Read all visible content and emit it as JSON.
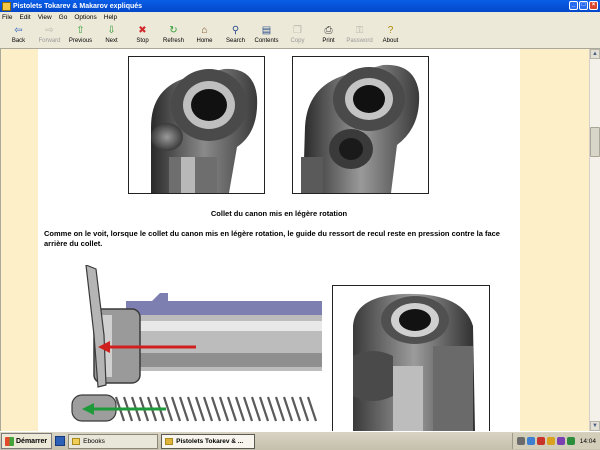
{
  "window": {
    "title": "Pistolets Tokarev & Makarov expliqués"
  },
  "menu": [
    "File",
    "Edit",
    "View",
    "Go",
    "Options",
    "Help"
  ],
  "toolbar": [
    {
      "label": "Back",
      "icon": "back-arrow-icon",
      "glyph": "⇦",
      "color": "#2f67c6",
      "enabled": true
    },
    {
      "label": "Forward",
      "icon": "forward-arrow-icon",
      "glyph": "⇨",
      "color": "#7b7b7b",
      "enabled": false
    },
    {
      "label": "Previous",
      "icon": "up-arrow-icon",
      "glyph": "⇧",
      "color": "#2f9c32",
      "enabled": true
    },
    {
      "label": "Next",
      "icon": "down-arrow-icon",
      "glyph": "⇩",
      "color": "#2f9c32",
      "enabled": true
    },
    {
      "label": "Stop",
      "icon": "stop-icon",
      "glyph": "✖",
      "color": "#d1282b",
      "enabled": true
    },
    {
      "label": "Refresh",
      "icon": "refresh-icon",
      "glyph": "↻",
      "color": "#2f9c32",
      "enabled": true
    },
    {
      "label": "Home",
      "icon": "home-icon",
      "glyph": "⌂",
      "color": "#7a4b1e",
      "enabled": true
    },
    {
      "label": "Search",
      "icon": "search-icon",
      "glyph": "⚲",
      "color": "#2b4e8a",
      "enabled": true
    },
    {
      "label": "Contents",
      "icon": "contents-icon",
      "glyph": "▤",
      "color": "#2b4e8a",
      "enabled": true
    },
    {
      "label": "Copy",
      "icon": "copy-icon",
      "glyph": "❐",
      "color": "#7b7b7b",
      "enabled": false
    },
    {
      "label": "Print",
      "icon": "print-icon",
      "glyph": "⎙",
      "color": "#3d3d3d",
      "enabled": true
    },
    {
      "label": "Password",
      "icon": "password-icon",
      "glyph": "⚿",
      "color": "#7b7b7b",
      "enabled": false
    },
    {
      "label": "About",
      "icon": "about-icon",
      "glyph": "?",
      "color": "#b08a00",
      "enabled": true
    }
  ],
  "content": {
    "caption": "Collet du canon mis en légère rotation",
    "paragraph": "Comme on le voit, lorsque le collet du canon mis en légère rotation, le guide du ressort de recul reste en pression contre la face arrière du collet."
  },
  "taskbar": {
    "start_label": "Démarrer",
    "tasks": [
      {
        "label": "Ebooks",
        "active": false
      },
      {
        "label": "Pistolets Tokarev & ...",
        "active": true
      }
    ],
    "clock": "14:04"
  }
}
